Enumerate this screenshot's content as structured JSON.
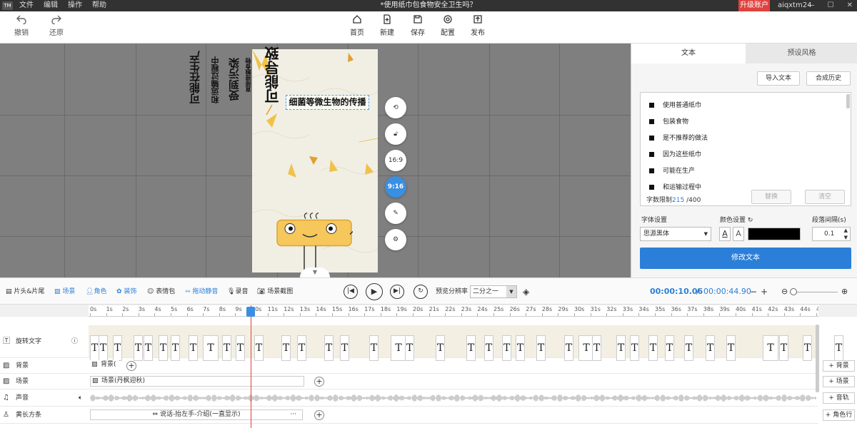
{
  "titlebar": {
    "logo": "TM",
    "menu": [
      "文件",
      "编辑",
      "操作",
      "帮助"
    ],
    "doc_title": "*使用纸巾包食物安全卫生吗？",
    "upgrade": "升级账户",
    "user": "aiqxtm24"
  },
  "toolbar": {
    "undo": "撤销",
    "redo": "还原",
    "home": "首页",
    "new": "新建",
    "save": "保存",
    "config": "配置",
    "publish": "发布"
  },
  "canvas": {
    "vertical_texts": [
      "可能在生产",
      "和运输过程中",
      "受到污染",
      "直接接触食物",
      "可能导致"
    ],
    "caption": "细菌等微生物的传播",
    "ratio_169": "16:9",
    "ratio_916": "9:16"
  },
  "right_panel": {
    "tab_text": "文本",
    "tab_style": "预设风格",
    "import_text": "导入文本",
    "synthesis_history": "合成历史",
    "text_items": [
      "使用普通纸巾",
      "包装食物",
      "是不推荐的做法",
      "因为这些纸巾",
      "可能在生产",
      "和运输过程中"
    ],
    "char_limit_label": "字数限制",
    "char_count": "215",
    "char_max": "/400",
    "replace": "替换",
    "clear": "清空",
    "font_settings": "字体设置",
    "color_settings": "颜色设置",
    "para_spacing": "段落间隔(s)",
    "font_value": "思源黑体",
    "spacing_value": "0.1",
    "modify_text": "修改文本",
    "text_color": "#000000"
  },
  "timeline_toolbar": {
    "intro_outro": "片头&片尾",
    "scene": "场景",
    "character": "角色",
    "decor": "装饰",
    "emoji": "表情包",
    "drag_silence": "拖动静音",
    "record": "录音",
    "scene_capture": "场景截图",
    "preview_res_label": "预览分辨率",
    "preview_res_value": "二分之一",
    "current_time": "00:00:10.06",
    "separator": "/",
    "total_time": "00:00:44.90"
  },
  "ruler": [
    "0s",
    "1s",
    "2s",
    "3s",
    "4s",
    "5s",
    "6s",
    "7s",
    "8s",
    "9s",
    "10s",
    "11s",
    "12s",
    "13s",
    "14s",
    "15s",
    "16s",
    "17s",
    "18s",
    "19s",
    "20s",
    "21s",
    "22s",
    "23s",
    "24s",
    "25s",
    "26s",
    "27s",
    "28s",
    "29s",
    "30s",
    "31s",
    "32s",
    "33s",
    "34s",
    "35s",
    "36s",
    "37s",
    "38s",
    "39s",
    "40s",
    "41s",
    "42s",
    "43s",
    "44s",
    "46s"
  ],
  "tracks": {
    "text_track": "旋转文字",
    "text_glyph": "T",
    "background": "背景",
    "background_clip": "背景(",
    "scene": "场景",
    "scene_clip": "场景(丹枫迎秋)",
    "audio": "声音",
    "role": "黄长方条",
    "role_clip": "说话-抬左手-介绍(一直显示)",
    "role_more": "···",
    "add_bg": "+ 背景",
    "add_scene": "+ 场景",
    "add_audio": "+ 音轨",
    "add_role": "+ 角色行"
  }
}
